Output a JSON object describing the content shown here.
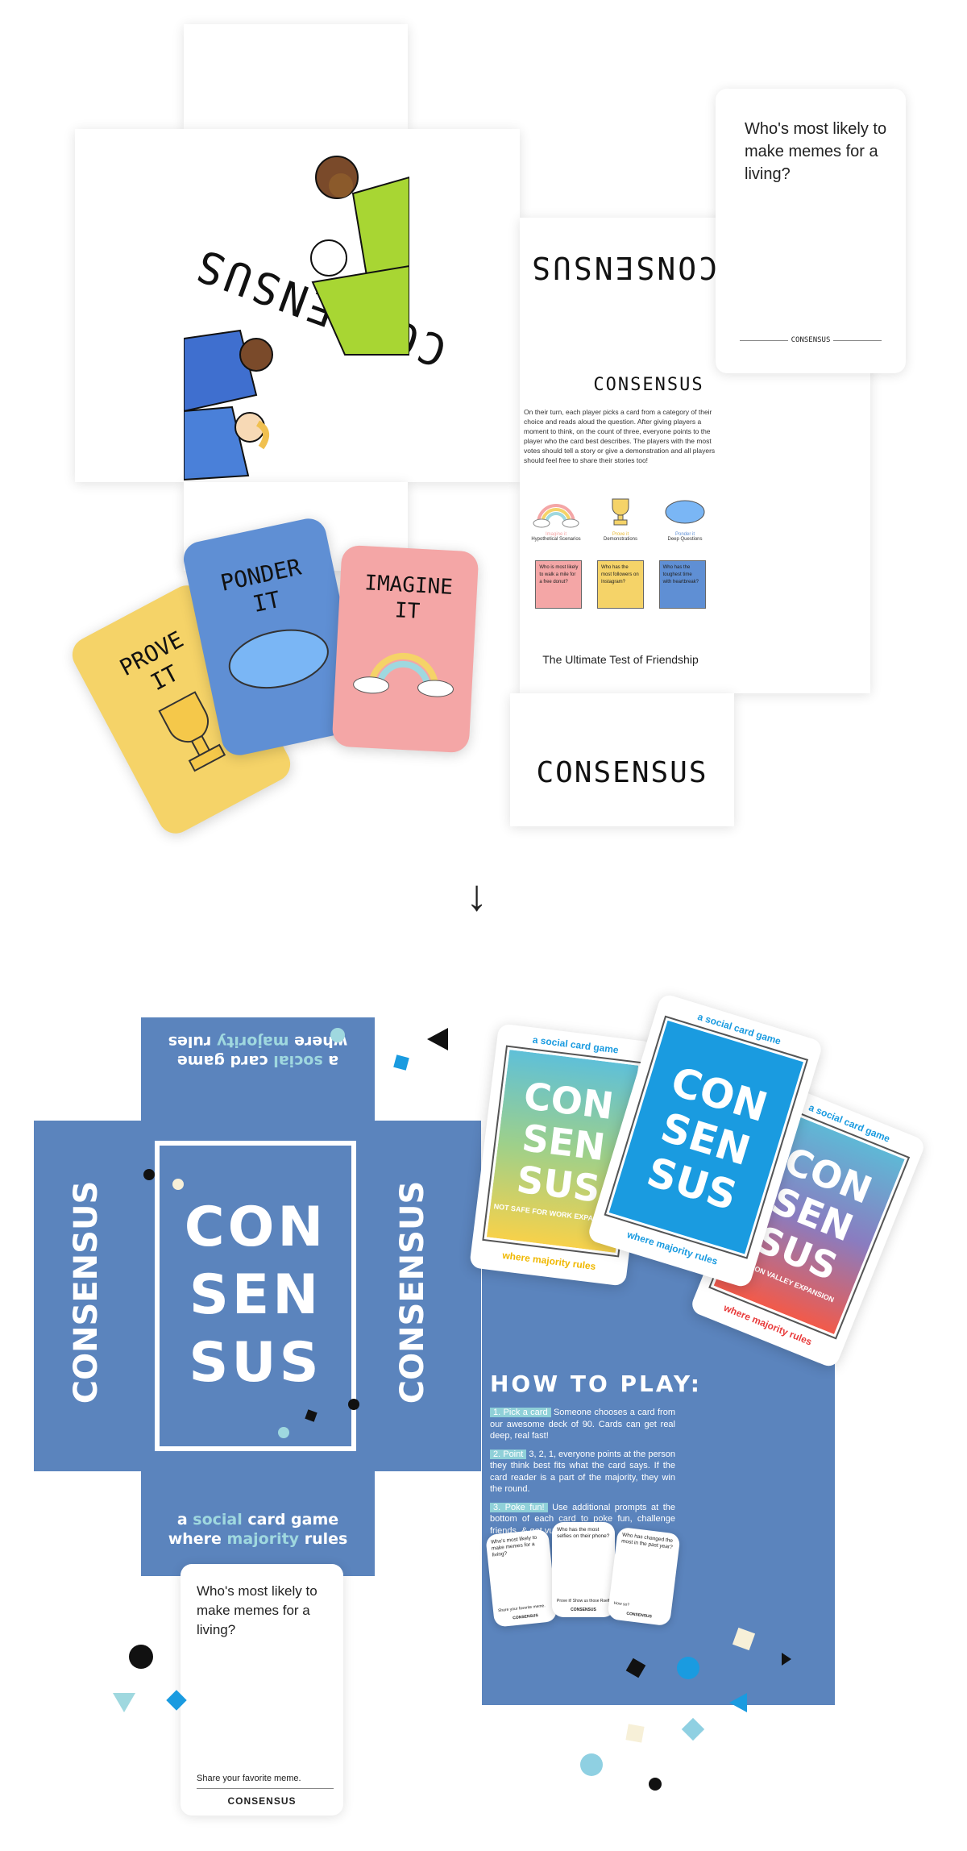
{
  "top": {
    "box_front_title": "CONSENSUS",
    "box_side_title": "CONSENSUS",
    "rules_title": "CONSENSUS",
    "rules_body": "On their turn, each player picks a card from a category of their choice and reads aloud the question. After giving players a moment to think, on the count of three, everyone points to the player who the card best describes. The players with the most votes should tell a story or give a demonstration and all players should feel free to share their stories too!",
    "categories": [
      {
        "name": "Imagine it",
        "sub": "Hypothetical Scenarios",
        "color": "#f4a6a6",
        "example": "Who is most likely to walk a mile for a free donut?"
      },
      {
        "name": "Prove it",
        "sub": "Demonstrations",
        "color": "#f5d368",
        "example": "Who has the most followers on Instagram?"
      },
      {
        "name": "Ponder it",
        "sub": "Deep Questions",
        "color": "#5f8fd4",
        "example": "Who has the toughest time with heartbreak?"
      }
    ],
    "tagline": "The Ultimate Test of Friendship",
    "bottom_title": "CONSENSUS",
    "question_card": {
      "text": "Who's most likely to make memes for a living?",
      "footer": "CONSENSUS"
    },
    "cards": {
      "prove": [
        "PROVE",
        "IT"
      ],
      "ponder": [
        "PONDER",
        "IT"
      ],
      "imagine": [
        "IMAGINE",
        "IT"
      ]
    }
  },
  "arrow": "↓",
  "bottom": {
    "logo_lines": [
      "CON",
      "SEN",
      "SUS"
    ],
    "side_title": "CONSENSUS",
    "tag_a": "a ",
    "tag_social": "social",
    "tag_b": " card game",
    "tag_c": "where ",
    "tag_majority": "majority",
    "tag_d": " rules",
    "how_title": "HOW TO PLAY:",
    "steps": [
      {
        "label": "1. Pick a card",
        "text": " Someone chooses a card from our awesome deck of 90. Cards can get real deep, real fast!"
      },
      {
        "label": "2. Point",
        "text": " 3, 2, 1, everyone points at the person they think best fits what the card says. If the card reader is a part of the majority, they win the round."
      },
      {
        "label": "3. Poke fun!",
        "text": " Use additional prompts at the bottom of each card to poke fun, challenge friends, & get vulnerable!"
      }
    ],
    "mini_cards": [
      {
        "q": "Who's most likely to make memes for a living?",
        "p": "Share your favorite meme.",
        "b": "CONSENSUS"
      },
      {
        "q": "Who has the most selfies on their phone?",
        "p": "Prove it! Show us those Rselfies",
        "b": "CONSENSUS"
      },
      {
        "q": "Who has changed the most in the past year?",
        "p": "How so?",
        "b": "CONSENSUS"
      }
    ],
    "question_card": {
      "text": "Who's most likely to make memes for a living?",
      "prompt": "Share your favorite meme.",
      "brand": "CONSENSUS"
    },
    "decks": [
      {
        "top": "a social card game",
        "sub": "NOT SAFE FOR WORK EXPANSION",
        "bottom": "where majority rules"
      },
      {
        "top": "a social card game",
        "sub": "",
        "bottom": "where majority rules"
      },
      {
        "top": "a social card game",
        "sub": "SILICON VALLEY EXPANSION",
        "bottom": "where majority rules"
      }
    ]
  },
  "colors": {
    "box_blue": "#5b84bd",
    "teal": "#9fd8df",
    "deck_blue": "#1a9be0"
  }
}
